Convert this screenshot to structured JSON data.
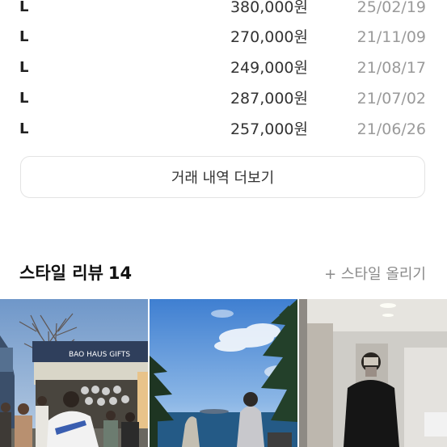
{
  "trades": [
    {
      "size": "L",
      "price": "380,000원",
      "date": "25/02/19"
    },
    {
      "size": "L",
      "price": "270,000원",
      "date": "21/11/09"
    },
    {
      "size": "L",
      "price": "249,000원",
      "date": "21/08/17"
    },
    {
      "size": "L",
      "price": "287,000원",
      "date": "21/07/02"
    },
    {
      "size": "L",
      "price": "257,000원",
      "date": "21/06/26"
    }
  ],
  "more_button": {
    "label": "거래 내역 더보기"
  },
  "style_reviews": {
    "title": "스타일 리뷰",
    "count": "14",
    "upload_label": "+ 스타일 올리기"
  },
  "photos": {
    "photo1_sign": "BAO HAUS GIFTS"
  }
}
